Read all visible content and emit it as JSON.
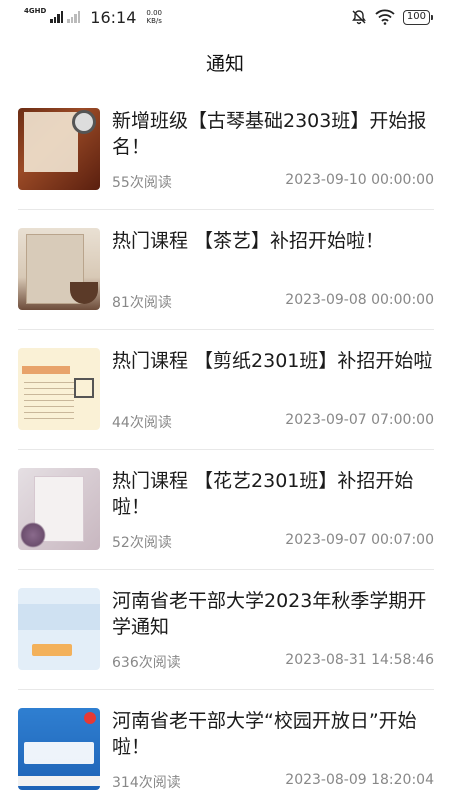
{
  "status_bar": {
    "network": "4GHD",
    "time": "16:14",
    "speed_value": "0.00",
    "speed_unit": "KB/s",
    "battery": "100"
  },
  "header": {
    "title": "通知"
  },
  "notices": [
    {
      "title": "新增班级【古琴基础2303班】开始报名！",
      "reads": "55次阅读",
      "date": "2023-09-10 00:00:00"
    },
    {
      "title": "热门课程 【茶艺】补招开始啦！",
      "reads": "81次阅读",
      "date": "2023-09-08 00:00:00"
    },
    {
      "title": "热门课程 【剪纸2301班】补招开始啦",
      "reads": "44次阅读",
      "date": "2023-09-07 07:00:00"
    },
    {
      "title": "热门课程 【花艺2301班】补招开始啦！",
      "reads": "52次阅读",
      "date": "2023-09-07 00:07:00"
    },
    {
      "title": "河南省老干部大学2023年秋季学期开学通知",
      "reads": "636次阅读",
      "date": "2023-08-31 14:58:46"
    },
    {
      "title": "河南省老干部大学“校园开放日”开始啦！",
      "reads": "314次阅读",
      "date": "2023-08-09 18:20:04"
    }
  ]
}
